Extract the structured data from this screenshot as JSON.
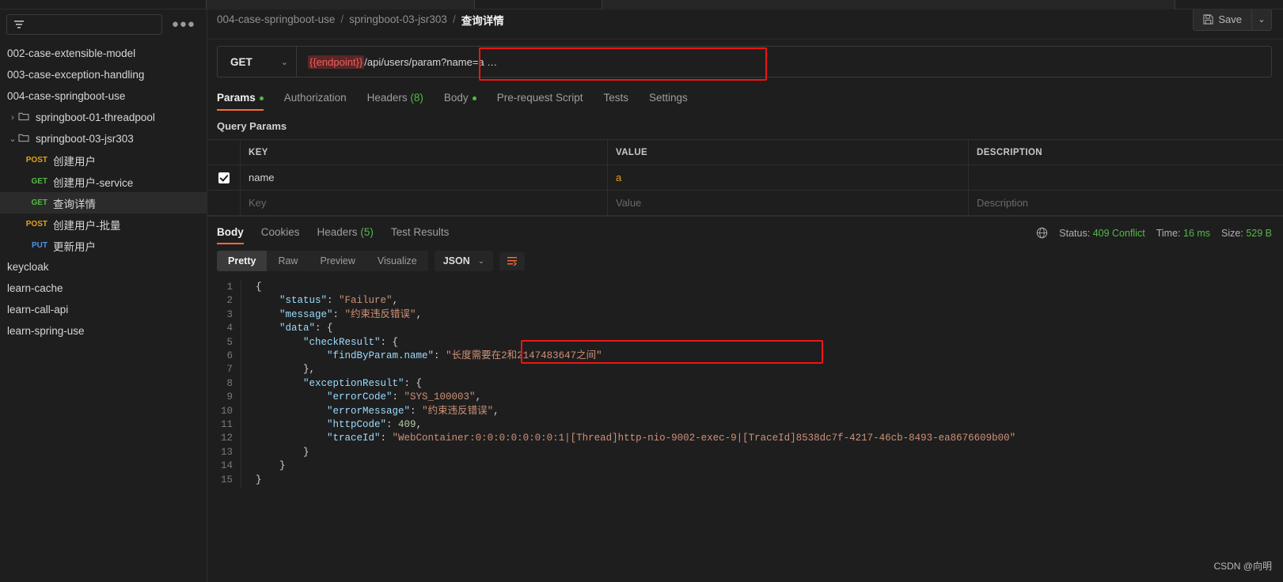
{
  "sidebar": {
    "filter_placeholder": "",
    "filter_icon": "filter-icon",
    "more_label": "●●●",
    "items": [
      {
        "label": "002-case-extensible-model",
        "type": "collection",
        "level": 0,
        "caret": "",
        "selected": false
      },
      {
        "label": "003-case-exception-handling",
        "type": "collection",
        "level": 0,
        "caret": "",
        "selected": false
      },
      {
        "label": "004-case-springboot-use",
        "type": "collection",
        "level": 0,
        "caret": "",
        "selected": false
      },
      {
        "label": "springboot-01-threadpool",
        "type": "folder",
        "level": 1,
        "caret": "›",
        "selected": false
      },
      {
        "label": "springboot-03-jsr303",
        "type": "folder",
        "level": 1,
        "caret": "⌄",
        "selected": false
      },
      {
        "label": "创建用户",
        "type": "request",
        "method": "POST",
        "level": 2,
        "selected": false
      },
      {
        "label": "创建用户-service",
        "type": "request",
        "method": "GET",
        "level": 2,
        "selected": false
      },
      {
        "label": "查询详情",
        "type": "request",
        "method": "GET",
        "level": 2,
        "selected": true
      },
      {
        "label": "创建用户-批量",
        "type": "request",
        "method": "POST",
        "level": 2,
        "selected": false
      },
      {
        "label": "更新用户",
        "type": "request",
        "method": "PUT",
        "level": 2,
        "selected": false
      },
      {
        "label": "keycloak",
        "type": "collection",
        "level": 0,
        "caret": "",
        "selected": false
      },
      {
        "label": "learn-cache",
        "type": "collection",
        "level": 0,
        "caret": "",
        "selected": false
      },
      {
        "label": "learn-call-api",
        "type": "collection",
        "level": 0,
        "caret": "",
        "selected": false
      },
      {
        "label": "learn-spring-use",
        "type": "collection",
        "level": 0,
        "caret": "",
        "selected": false
      }
    ]
  },
  "header": {
    "breadcrumb": [
      "004-case-springboot-use",
      "springboot-03-jsr303",
      "查询详情"
    ],
    "separator": "/",
    "save_label": "Save",
    "save_caret": "⌄"
  },
  "request": {
    "method": "GET",
    "method_caret": "⌄",
    "url_variable": "{{endpoint}}",
    "url_rest": "/api/users/param?name=a …",
    "tabs": [
      {
        "label": "Params",
        "active": true,
        "dot": true,
        "count": ""
      },
      {
        "label": "Authorization",
        "active": false,
        "dot": false,
        "count": ""
      },
      {
        "label": "Headers",
        "active": false,
        "dot": false,
        "count": "(8)"
      },
      {
        "label": "Body",
        "active": false,
        "dot": true,
        "count": ""
      },
      {
        "label": "Pre-request Script",
        "active": false,
        "dot": false,
        "count": ""
      },
      {
        "label": "Tests",
        "active": false,
        "dot": false,
        "count": ""
      },
      {
        "label": "Settings",
        "active": false,
        "dot": false,
        "count": ""
      }
    ],
    "query_params_title": "Query Params",
    "table": {
      "headers": [
        "KEY",
        "VALUE",
        "DESCRIPTION"
      ],
      "rows": [
        {
          "checked": true,
          "key": "name",
          "value": "a",
          "description": ""
        }
      ],
      "placeholder_row": {
        "key": "Key",
        "value": "Value",
        "description": "Description"
      }
    }
  },
  "response": {
    "tabs": [
      {
        "label": "Body",
        "active": true,
        "count": ""
      },
      {
        "label": "Cookies",
        "active": false,
        "count": ""
      },
      {
        "label": "Headers",
        "active": false,
        "count": "(5)"
      },
      {
        "label": "Test Results",
        "active": false,
        "count": ""
      }
    ],
    "status_icon": "globe-icon",
    "status_label": "Status:",
    "status_value": "409 Conflict",
    "time_label": "Time:",
    "time_value": "16 ms",
    "size_label": "Size:",
    "size_value": "529 B",
    "view_modes": [
      {
        "label": "Pretty",
        "active": true
      },
      {
        "label": "Raw",
        "active": false
      },
      {
        "label": "Preview",
        "active": false
      },
      {
        "label": "Visualize",
        "active": false
      }
    ],
    "format": "JSON",
    "format_caret": "⌄",
    "wrap_icon": "wrap-lines-icon",
    "line_numbers": [
      "1",
      "2",
      "3",
      "4",
      "5",
      "6",
      "7",
      "8",
      "9",
      "10",
      "11",
      "12",
      "13",
      "14",
      "15"
    ],
    "body_lines": [
      [
        {
          "t": "{",
          "c": "p"
        }
      ],
      [
        {
          "t": "    ",
          "c": "p"
        },
        {
          "t": "\"status\"",
          "c": "k"
        },
        {
          "t": ": ",
          "c": "p"
        },
        {
          "t": "\"Failure\"",
          "c": "s"
        },
        {
          "t": ",",
          "c": "p"
        }
      ],
      [
        {
          "t": "    ",
          "c": "p"
        },
        {
          "t": "\"message\"",
          "c": "k"
        },
        {
          "t": ": ",
          "c": "p"
        },
        {
          "t": "\"约束违反错误\"",
          "c": "s"
        },
        {
          "t": ",",
          "c": "p"
        }
      ],
      [
        {
          "t": "    ",
          "c": "p"
        },
        {
          "t": "\"data\"",
          "c": "k"
        },
        {
          "t": ": {",
          "c": "p"
        }
      ],
      [
        {
          "t": "        ",
          "c": "p"
        },
        {
          "t": "\"checkResult\"",
          "c": "k"
        },
        {
          "t": ": {",
          "c": "p"
        }
      ],
      [
        {
          "t": "            ",
          "c": "p"
        },
        {
          "t": "\"findByParam.name\"",
          "c": "k"
        },
        {
          "t": ": ",
          "c": "p"
        },
        {
          "t": "\"长度需要在2和2147483647之间\"",
          "c": "s"
        }
      ],
      [
        {
          "t": "        },",
          "c": "p"
        }
      ],
      [
        {
          "t": "        ",
          "c": "p"
        },
        {
          "t": "\"exceptionResult\"",
          "c": "k"
        },
        {
          "t": ": {",
          "c": "p"
        }
      ],
      [
        {
          "t": "            ",
          "c": "p"
        },
        {
          "t": "\"errorCode\"",
          "c": "k"
        },
        {
          "t": ": ",
          "c": "p"
        },
        {
          "t": "\"SYS_100003\"",
          "c": "s"
        },
        {
          "t": ",",
          "c": "p"
        }
      ],
      [
        {
          "t": "            ",
          "c": "p"
        },
        {
          "t": "\"errorMessage\"",
          "c": "k"
        },
        {
          "t": ": ",
          "c": "p"
        },
        {
          "t": "\"约束违反错误\"",
          "c": "s"
        },
        {
          "t": ",",
          "c": "p"
        }
      ],
      [
        {
          "t": "            ",
          "c": "p"
        },
        {
          "t": "\"httpCode\"",
          "c": "k"
        },
        {
          "t": ": ",
          "c": "p"
        },
        {
          "t": "409",
          "c": "n"
        },
        {
          "t": ",",
          "c": "p"
        }
      ],
      [
        {
          "t": "            ",
          "c": "p"
        },
        {
          "t": "\"traceId\"",
          "c": "k"
        },
        {
          "t": ": ",
          "c": "p"
        },
        {
          "t": "\"WebContainer:0:0:0:0:0:0:0:1|[Thread]http-nio-9002-exec-9|[TraceId]8538dc7f-4217-46cb-8493-ea8676609b00\"",
          "c": "s"
        }
      ],
      [
        {
          "t": "        }",
          "c": "p"
        }
      ],
      [
        {
          "t": "    }",
          "c": "p"
        }
      ],
      [
        {
          "t": "}",
          "c": "p"
        }
      ]
    ]
  },
  "annotations": {
    "highlight_color": "#f01414",
    "url_highlight": true,
    "json_highlight": true
  },
  "watermark": "CSDN @向明"
}
